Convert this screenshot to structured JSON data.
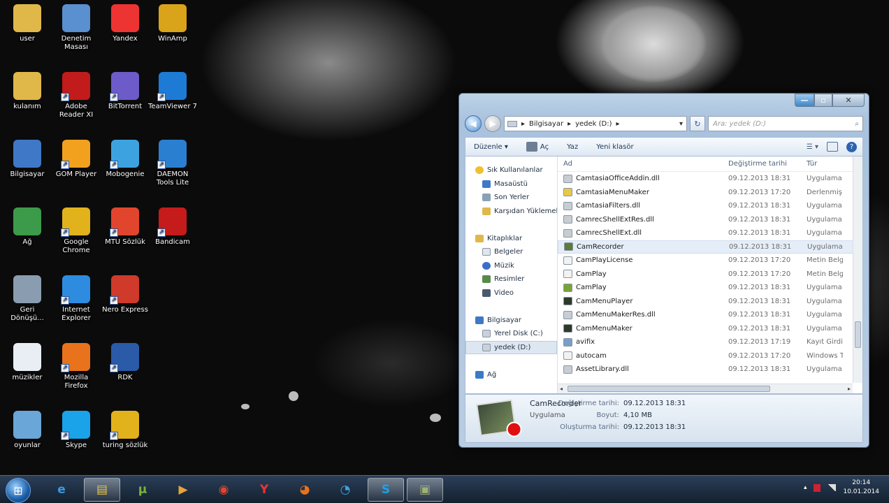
{
  "desktop": {
    "icons": [
      {
        "label": "user",
        "icon": "user-folder-icon",
        "color": "#e0b84a"
      },
      {
        "label": "Denetim Masası",
        "icon": "control-panel-icon",
        "color": "#5a8fd0"
      },
      {
        "label": "Yandex",
        "icon": "yandex-icon",
        "color": "#e33"
      },
      {
        "label": "WinAmp",
        "icon": "winamp-icon",
        "color": "#d9a31a"
      },
      {
        "label": "kulanım",
        "icon": "folder-icon",
        "color": "#e0b84a"
      },
      {
        "label": "Adobe Reader XI",
        "icon": "adobe-reader-icon",
        "color": "#c21b1b"
      },
      {
        "label": "BitTorrent",
        "icon": "bittorrent-icon",
        "color": "#6c5bc9"
      },
      {
        "label": "TeamViewer 7",
        "icon": "teamviewer-icon",
        "color": "#1d7bd6"
      },
      {
        "label": "Bilgisayar",
        "icon": "computer-icon",
        "color": "#3f78c6"
      },
      {
        "label": "GOM Player",
        "icon": "gom-player-icon",
        "color": "#f2a11f"
      },
      {
        "label": "Mobogenie",
        "icon": "mobogenie-icon",
        "color": "#3da3e0"
      },
      {
        "label": "DAEMON Tools Lite",
        "icon": "daemon-tools-icon",
        "color": "#2b7fd0"
      },
      {
        "label": "Ağ",
        "icon": "network-icon",
        "color": "#3c9b4a"
      },
      {
        "label": "Google Chrome",
        "icon": "chrome-icon",
        "color": "#e2b21c"
      },
      {
        "label": "MTU Sözlük",
        "icon": "mtu-dictionary-icon",
        "color": "#e2452e"
      },
      {
        "label": "Bandicam",
        "icon": "bandicam-icon",
        "color": "#c51b1b"
      },
      {
        "label": "Geri Dönüşü...",
        "icon": "recycle-bin-icon",
        "color": "#8a9db0"
      },
      {
        "label": "Internet Explorer",
        "icon": "internet-explorer-icon",
        "color": "#2d8ce0"
      },
      {
        "label": "Nero Express",
        "icon": "nero-express-icon",
        "color": "#cf3a2a"
      },
      {
        "label": "müzikler",
        "icon": "music-file-icon",
        "color": "#e8eef4"
      },
      {
        "label": "Mozilla Firefox",
        "icon": "firefox-icon",
        "color": "#e8731c"
      },
      {
        "label": "RDK",
        "icon": "shortcut-icon",
        "color": "#2a5aa8"
      },
      {
        "label": "oyunlar",
        "icon": "games-folder-icon",
        "color": "#6aa6d8"
      },
      {
        "label": "Skype",
        "icon": "skype-icon",
        "color": "#1aa3e8"
      },
      {
        "label": "turing sözlük",
        "icon": "turing-dictionary-icon",
        "color": "#e2b21c"
      }
    ]
  },
  "explorer": {
    "controls": {
      "minimize": "—",
      "maximize": "▫",
      "close": "✕"
    },
    "address": {
      "crumbs": [
        "Bilgisayar",
        "yedek (D:)"
      ],
      "separator": "▸",
      "dropdown": "▾",
      "refresh": "↻"
    },
    "search": {
      "placeholder": "Ara: yedek (D:)",
      "icon": "⌕"
    },
    "toolbar": {
      "organize": "Düzenle ▾",
      "open": "Aç",
      "burn": "Yaz",
      "new_folder": "Yeni klasör"
    },
    "nav": {
      "favorites": {
        "header": "Sık Kullanılanlar",
        "items": [
          "Masaüstü",
          "Son Yerler",
          "Karşıdan Yüklemeler"
        ]
      },
      "libraries": {
        "header": "Kitaplıklar",
        "items": [
          "Belgeler",
          "Müzik",
          "Resimler",
          "Video"
        ]
      },
      "computer": {
        "header": "Bilgisayar",
        "items": [
          "Yerel Disk (C:)",
          "yedek (D:)"
        ]
      },
      "network": {
        "header": "Ağ"
      }
    },
    "columns": {
      "name": "Ad",
      "date": "Değiştirme tarihi",
      "type": "Tür"
    },
    "files": [
      {
        "name": "CamtasiaOfficeAddin.dll",
        "date": "09.12.2013 18:31",
        "type": "Uygulama",
        "color": "#c8cdd3"
      },
      {
        "name": "CamtasiaMenuMaker",
        "date": "09.12.2013 17:20",
        "type": "Derlenmiş",
        "color": "#e8c84a"
      },
      {
        "name": "CamtasiaFilters.dll",
        "date": "09.12.2013 18:31",
        "type": "Uygulama",
        "color": "#c8cdd3"
      },
      {
        "name": "CamrecShellExtRes.dll",
        "date": "09.12.2013 18:31",
        "type": "Uygulama",
        "color": "#c8cdd3"
      },
      {
        "name": "CamrecShellExt.dll",
        "date": "09.12.2013 18:31",
        "type": "Uygulama",
        "color": "#c8cdd3"
      },
      {
        "name": "CamRecorder",
        "date": "09.12.2013 18:31",
        "type": "Uygulama",
        "color": "#5c7a3c"
      },
      {
        "name": "CamPlayLicense",
        "date": "09.12.2013 17:20",
        "type": "Metin Belg",
        "color": "#f2f2f2"
      },
      {
        "name": "CamPlay",
        "date": "09.12.2013 17:20",
        "type": "Metin Belg",
        "color": "#f2f2f2"
      },
      {
        "name": "CamPlay",
        "date": "09.12.2013 18:31",
        "type": "Uygulama",
        "color": "#7aa23a"
      },
      {
        "name": "CamMenuPlayer",
        "date": "09.12.2013 18:31",
        "type": "Uygulama",
        "color": "#2d3a2a"
      },
      {
        "name": "CamMenuMakerRes.dll",
        "date": "09.12.2013 18:31",
        "type": "Uygulama",
        "color": "#c8cdd3"
      },
      {
        "name": "CamMenuMaker",
        "date": "09.12.2013 18:31",
        "type": "Uygulama",
        "color": "#2d3a2a"
      },
      {
        "name": "avifix",
        "date": "09.12.2013 17:19",
        "type": "Kayıt Girdi",
        "color": "#7a9ec8"
      },
      {
        "name": "autocam",
        "date": "09.12.2013 17:20",
        "type": "Windows T",
        "color": "#f2f2f2"
      },
      {
        "name": "AssetLibrary.dll",
        "date": "09.12.2013 18:31",
        "type": "Uygulama",
        "color": "#c8cdd3"
      }
    ],
    "scroll": {
      "left": "◂",
      "right": "▸",
      "grip": "|||"
    },
    "details": {
      "name": "CamRecorder",
      "type": "Uygulama",
      "modified_label": "Değiştirme tarihi:",
      "modified_value": "09.12.2013 18:31",
      "size_label": "Boyut:",
      "size_value": "4,10 MB",
      "created_label": "Oluşturma tarihi:",
      "created_value": "09.12.2013 18:31"
    }
  },
  "taskbar": {
    "start": "⊞",
    "items": [
      {
        "name": "internet-explorer",
        "glyph": "e",
        "color": "#3a9ae8"
      },
      {
        "name": "explorer",
        "glyph": "▤",
        "color": "#e8c84a"
      },
      {
        "name": "utorrent",
        "glyph": "µ",
        "color": "#7ab33a"
      },
      {
        "name": "media-player",
        "glyph": "▶",
        "color": "#e8a23a"
      },
      {
        "name": "chrome",
        "glyph": "◉",
        "color": "#e2452e"
      },
      {
        "name": "yandex",
        "glyph": "Y",
        "color": "#e33"
      },
      {
        "name": "firefox",
        "glyph": "◕",
        "color": "#e8731c"
      },
      {
        "name": "mobogenie",
        "glyph": "◔",
        "color": "#3da3e0"
      },
      {
        "name": "skype",
        "glyph": "S",
        "color": "#1aa3e8"
      },
      {
        "name": "camrecorder",
        "glyph": "▣",
        "color": "#9cb07a"
      }
    ],
    "tray": {
      "expand": "▴",
      "time": "20:14",
      "date": "10.01.2014"
    }
  }
}
